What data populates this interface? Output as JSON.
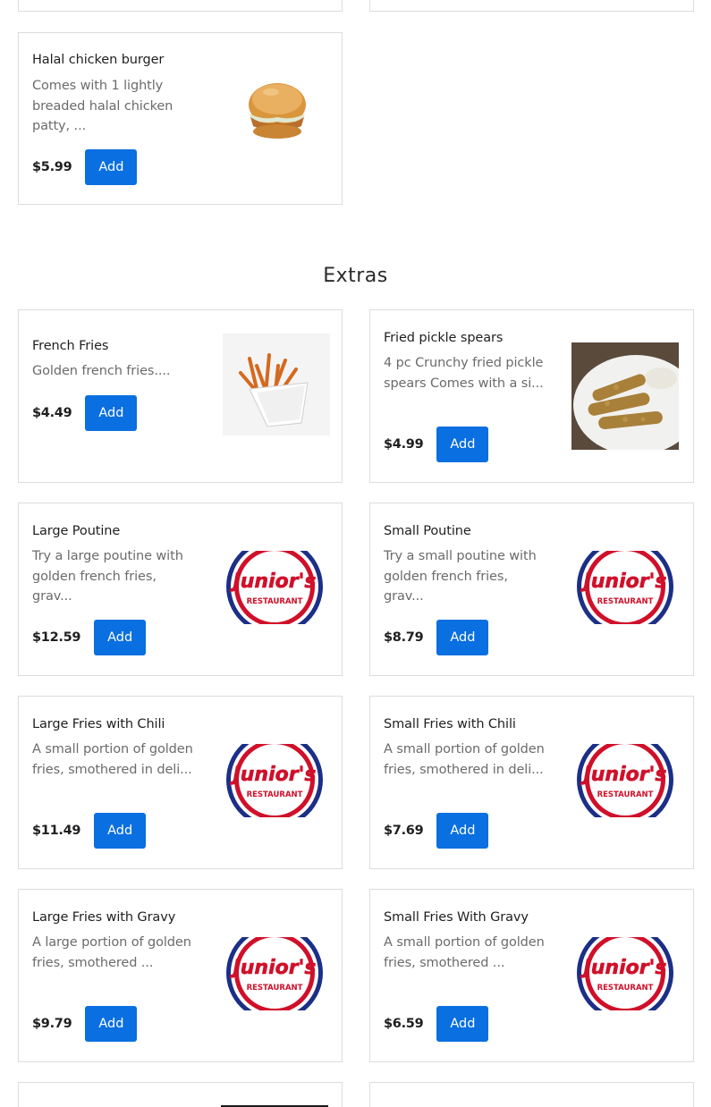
{
  "section": {
    "title": "Extras"
  },
  "brand": {
    "logo_word": "Junior's",
    "logo_sub": "RESTAURANT",
    "red": "#d0102a",
    "blue": "#1c2f87"
  },
  "colors": {
    "add_button": "#0a6fe0",
    "price": "#1f1f1f",
    "desc": "#6b6b6b"
  },
  "items": [
    {
      "name": "Halal chicken burger",
      "desc": "Comes with 1 lightly breaded halal chicken patty, ...",
      "price": "$5.99",
      "add": "Add",
      "image": "burger-image"
    },
    {
      "name": "French Fries",
      "desc": "Golden french fries....",
      "price": "$4.49",
      "add": "Add",
      "image": "fries-image"
    },
    {
      "name": "Fried pickle spears",
      "desc": "4 pc Crunchy fried pickle spears Comes with a si...",
      "price": "$4.99",
      "add": "Add",
      "image": "pickles-image"
    },
    {
      "name": "Large Poutine",
      "desc": "Try a large poutine with golden french fries, grav...",
      "price": "$12.59",
      "add": "Add",
      "image": "juniors-logo"
    },
    {
      "name": "Small Poutine",
      "desc": "Try a small poutine with golden french fries, grav...",
      "price": "$8.79",
      "add": "Add",
      "image": "juniors-logo"
    },
    {
      "name": "Large Fries with Chili",
      "desc": "A small portion of golden fries, smothered in deli...",
      "price": "$11.49",
      "add": "Add",
      "image": "juniors-logo"
    },
    {
      "name": "Small Fries with Chili",
      "desc": "A small portion of golden fries, smothered in deli...",
      "price": "$7.69",
      "add": "Add",
      "image": "juniors-logo"
    },
    {
      "name": "Large Fries with Gravy",
      "desc": "A large portion of golden fries, smothered ...",
      "price": "$9.79",
      "add": "Add",
      "image": "juniors-logo"
    },
    {
      "name": "Small Fries With Gravy",
      "desc": "A small portion of golden fries, smothered ...",
      "price": "$6.59",
      "add": "Add",
      "image": "juniors-logo"
    }
  ]
}
